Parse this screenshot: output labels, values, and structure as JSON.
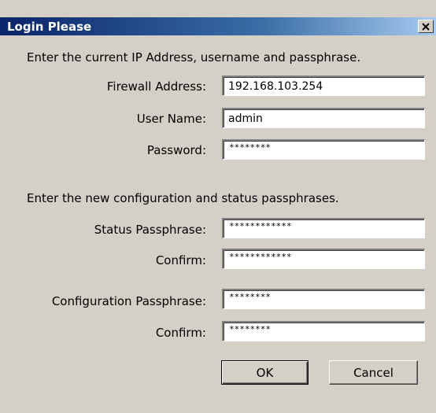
{
  "dialog": {
    "title": "Login Please",
    "close_glyph": "✕"
  },
  "section1": {
    "intro": "Enter the current IP Address, username and passphrase.",
    "firewall_label": "Firewall Address:",
    "firewall_value": "192.168.103.254",
    "username_label": "User Name:",
    "username_value": "admin",
    "password_label": "Password:",
    "password_value": "********"
  },
  "section2": {
    "intro": "Enter the new configuration and status passphrases.",
    "status_label": "Status Passphrase:",
    "status_value": "************",
    "status_confirm_label": "Confirm:",
    "status_confirm_value": "************",
    "config_label": "Configuration Passphrase:",
    "config_value": "********",
    "config_confirm_label": "Confirm:",
    "config_confirm_value": "********"
  },
  "buttons": {
    "ok": "OK",
    "cancel": "Cancel"
  }
}
